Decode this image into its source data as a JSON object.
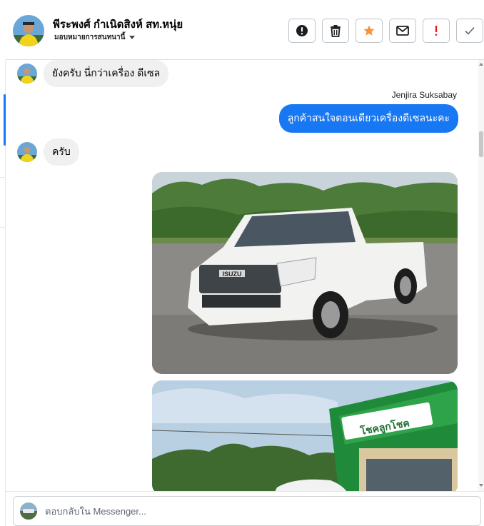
{
  "header": {
    "name": "พีระพงศ์ กำเนิดสิงห์ สท.หนุ่ย",
    "subtitle": "มอบหมายการสนทนานี้",
    "actions": [
      {
        "icon": "alert-circle-icon",
        "label": "Mark as spam"
      },
      {
        "icon": "trash-icon",
        "label": "Delete"
      },
      {
        "icon": "star-icon",
        "label": "Star"
      },
      {
        "icon": "envelope-icon",
        "label": "Mark as unread"
      },
      {
        "icon": "exclamation-icon",
        "label": "Follow up"
      },
      {
        "icon": "check-icon",
        "label": "Done"
      }
    ]
  },
  "messages": {
    "m1": "ยังครับ นี่กว่าเครื่อง ดีเซล",
    "sender": "Jenjira Suksabay",
    "m2": "ลูกค้าสนใจตอนเดียวเครื่องดีเซลนะคะ",
    "m3": "ครับ",
    "photos": [
      {
        "description": "white-isuzu-pickup-truck-photo"
      },
      {
        "description": "car-dealership-storefront-photo"
      }
    ]
  },
  "photo_text": {
    "badge": "ISUZU",
    "sign": "โชคลูกโชค"
  },
  "composer": {
    "placeholder": "ตอบกลับใน Messenger..."
  },
  "colors": {
    "accent": "#1877f2",
    "star": "#f7923b",
    "alert": "#ed1c24",
    "bubble_in": "#f0f0f0"
  }
}
